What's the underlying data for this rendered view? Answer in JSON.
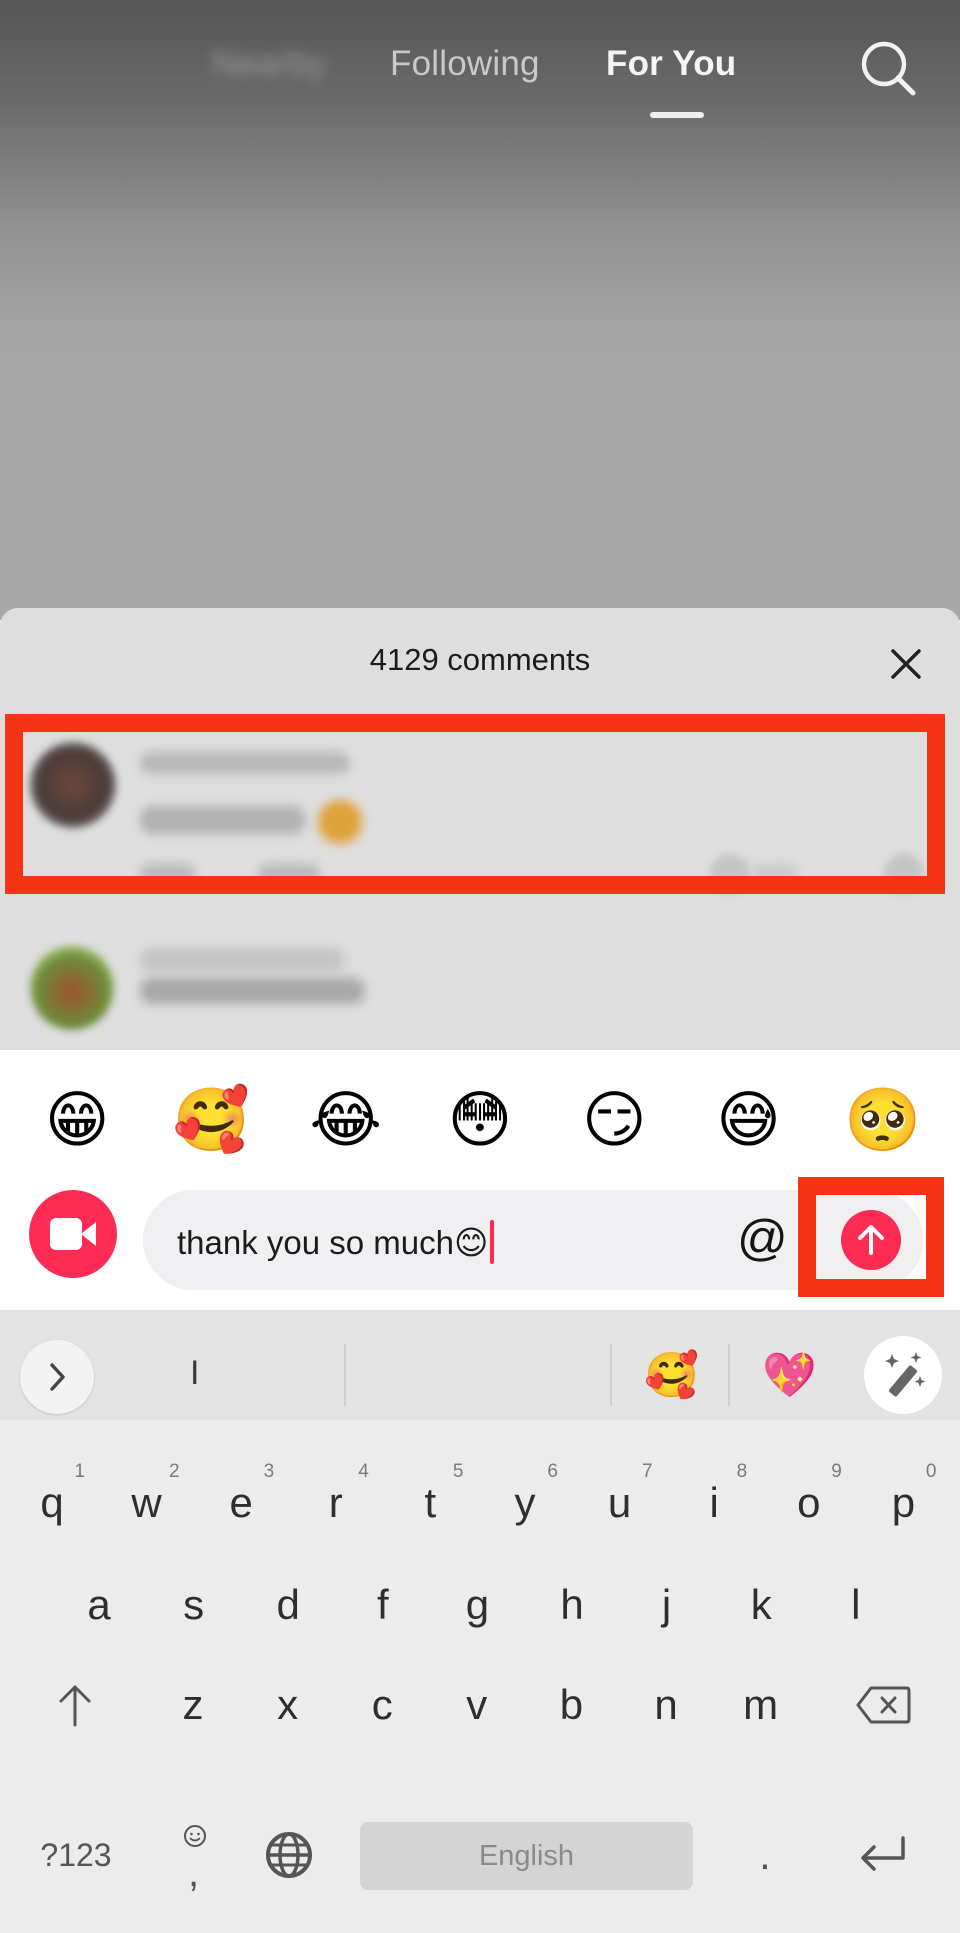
{
  "top_nav": {
    "tabs": [
      {
        "label": "Nearby",
        "state": "blurred"
      },
      {
        "label": "Following",
        "state": "inactive"
      },
      {
        "label": "For You",
        "state": "active"
      }
    ],
    "search_icon": "search-icon"
  },
  "comments_sheet": {
    "title": "4129 comments",
    "close_icon": "close-icon",
    "comments": [
      {
        "username": "[blurred]",
        "text": "[blurred]",
        "meta": "[blurred]",
        "reply_label": "[blurred]",
        "highlighted": true
      },
      {
        "view_replies": "[blurred]"
      },
      {
        "username": "[blurred]"
      }
    ]
  },
  "compose": {
    "quick_emojis": [
      "😁",
      "🥰",
      "😂",
      "😳",
      "😏",
      "😅",
      "🥺"
    ],
    "video_icon": "video-camera-icon",
    "input_value": "thank you so much😊",
    "mention_label": "@",
    "send_icon": "arrow-up-icon",
    "highlight_color": "#f43415",
    "accent_color": "#fe2c55"
  },
  "keyboard": {
    "suggestions": {
      "expand_icon": "chevron-right-icon",
      "word": "I",
      "emojis": [
        "🥰",
        "💖"
      ],
      "magic_icon": "magic-wand-icon"
    },
    "row1": [
      {
        "key": "q",
        "hint": "1"
      },
      {
        "key": "w",
        "hint": "2"
      },
      {
        "key": "e",
        "hint": "3"
      },
      {
        "key": "r",
        "hint": "4"
      },
      {
        "key": "t",
        "hint": "5"
      },
      {
        "key": "y",
        "hint": "6"
      },
      {
        "key": "u",
        "hint": "7"
      },
      {
        "key": "i",
        "hint": "8"
      },
      {
        "key": "o",
        "hint": "9"
      },
      {
        "key": "p",
        "hint": "0"
      }
    ],
    "row2": [
      "a",
      "s",
      "d",
      "f",
      "g",
      "h",
      "j",
      "k",
      "l"
    ],
    "row3": [
      "z",
      "x",
      "c",
      "v",
      "b",
      "n",
      "m"
    ],
    "shift_icon": "shift-arrow-icon",
    "backspace_icon": "backspace-icon",
    "symbols_label": "?123",
    "comma_label": ",",
    "emoji_hint_icon": "smiley-icon",
    "globe_icon": "globe-icon",
    "space_label": "English",
    "period_label": ".",
    "enter_icon": "enter-icon"
  }
}
